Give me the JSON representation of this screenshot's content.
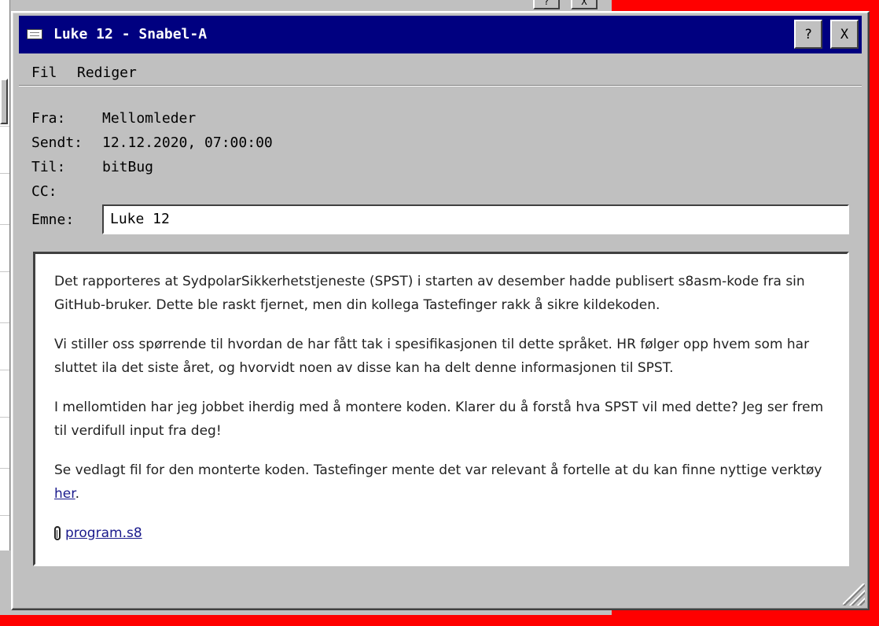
{
  "background_window": {
    "help_label": "?",
    "close_label": "X"
  },
  "window": {
    "title": "Luke 12 - Snabel-A",
    "help_label": "?",
    "close_label": "X"
  },
  "menu": {
    "items": [
      {
        "label": "Fil"
      },
      {
        "label": "Rediger"
      }
    ]
  },
  "header": {
    "from_label": "Fra:",
    "from_value": "Mellomleder",
    "sent_label": "Sendt:",
    "sent_value": "12.12.2020, 07:00:00",
    "to_label": "Til:",
    "to_value": "bitBug",
    "cc_label": "CC:",
    "cc_value": "",
    "subject_label": "Emne:",
    "subject_value": "Luke 12"
  },
  "body": {
    "p1": "Det rapporteres at SydpolarSikkerhetstjeneste (SPST) i starten av desember hadde publisert s8asm-kode fra sin GitHub-bruker. Dette ble raskt fjernet, men din kollega Tastefinger rakk å sikre kildekoden.",
    "p2": "Vi stiller oss spørrende til hvordan de har fått tak i spesifikasjonen til dette språket. HR følger opp hvem som har sluttet ila det siste året, og hvorvidt noen av disse kan ha delt denne informasjonen til SPST.",
    "p3": "I mellomtiden har jeg jobbet iherdig med å montere koden. Klarer du å forstå hva SPST vil med dette? Jeg ser frem til verdifull input fra deg!",
    "p4_text": "Se vedlagt fil for den monterte koden. Tastefinger mente det var relevant å fortelle at du kan finne nyttige verktøy ",
    "p4_link": "her",
    "p4_end": ".",
    "attachment": "program.s8"
  },
  "colors": {
    "desktop": "#ff0000",
    "titlebar": "#000080",
    "window": "#c0c0c0"
  },
  "icons": {
    "title": "envelope-icon",
    "attachment": "paperclip-icon",
    "resize": "resize-grip-icon"
  }
}
